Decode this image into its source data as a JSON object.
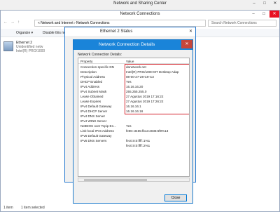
{
  "nsc": {
    "title": "Network and Sharing Center"
  },
  "nc": {
    "title": "Network Connections",
    "address": "« Network and Internet › Network Connections",
    "search_placeholder": "Search Network Connections",
    "cmd_organize": "Organize ▾",
    "cmd_disable": "Disable this ne",
    "adapter": {
      "name": "Ethernet 2",
      "status": "Unidentified netw",
      "device": "Intel(R) PRO/1000"
    },
    "status_count": "1 item",
    "status_selected": "1 item selected"
  },
  "es": {
    "title": "Ethernet 2 Status"
  },
  "ncd": {
    "title": "Network Connection Details",
    "label": "Network Connection Details:",
    "col_property": "Property",
    "col_value": "Value",
    "rows": [
      {
        "p": "Connection-specific DN",
        "v": "danetwork.net"
      },
      {
        "p": "Description",
        "v": "Intel(R) PRO/1000 MT Desktop Adap"
      },
      {
        "p": "Physical Address",
        "v": "08-00-27-28-C9-C3"
      },
      {
        "p": "DHCP Enabled",
        "v": "Yes"
      },
      {
        "p": "IPv4 Address",
        "v": "16.16.16.20"
      },
      {
        "p": "IPv4 Subnet Mask",
        "v": "255.255.255.0"
      },
      {
        "p": "Lease Obtained",
        "v": "27 Agustus 2019 17:16:22"
      },
      {
        "p": "Lease Expires",
        "v": "27 Agustus 2019 17:26:22"
      },
      {
        "p": "IPv4 Default Gateway",
        "v": "16.16.16.1"
      },
      {
        "p": "IPv4 DHCP Server",
        "v": "16.16.16.16"
      },
      {
        "p": "IPv4 DNS Server",
        "v": ""
      },
      {
        "p": "IPv4 WINS Server",
        "v": ""
      },
      {
        "p": "NetBIOS over Tcpip En...",
        "v": "Yes"
      },
      {
        "p": "Link-local IPv6 Address",
        "v": "fe80::3455:fb13:2036:6f9%13"
      },
      {
        "p": "IPv6 Default Gateway",
        "v": ""
      },
      {
        "p": "IPv6 DNS Servers",
        "v": "fec0:0:0:ffff::1%1"
      },
      {
        "p": "",
        "v": "fec0:0:0:ffff::2%1"
      }
    ],
    "close_label": "Close"
  }
}
